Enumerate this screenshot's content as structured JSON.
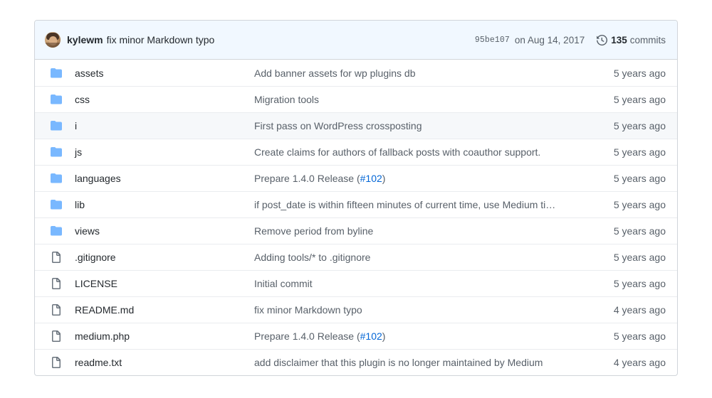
{
  "commit_bar": {
    "avatar_name": "avatar",
    "author": "kylewm",
    "message": "fix minor Markdown typo",
    "sha": "95be107",
    "date": "on Aug 14, 2017",
    "history_icon": "history-clock-icon",
    "commits_count": "135",
    "commits_label": "commits"
  },
  "colors": {
    "folder_blue": "#79b8ff",
    "file_gray": "#6a737d",
    "link_blue": "#0366d6",
    "header_bg": "#f1f8ff",
    "hover_bg": "#f6f8fa",
    "border": "#d1d5da",
    "text": "#24292e",
    "muted": "#586069"
  },
  "rows": [
    {
      "icon": "folder-icon",
      "type": "dir",
      "name": "assets",
      "message": "Add banner assets for wp plugins db",
      "link": null,
      "message_suffix": null,
      "age": "5 years ago",
      "hovered": false
    },
    {
      "icon": "folder-icon",
      "type": "dir",
      "name": "css",
      "message": "Migration tools",
      "link": null,
      "message_suffix": null,
      "age": "5 years ago",
      "hovered": false
    },
    {
      "icon": "folder-icon",
      "type": "dir",
      "name": "i",
      "message": "First pass on WordPress crossposting",
      "link": null,
      "message_suffix": null,
      "age": "5 years ago",
      "hovered": true
    },
    {
      "icon": "folder-icon",
      "type": "dir",
      "name": "js",
      "message": "Create claims for authors of fallback posts with coauthor support.",
      "link": null,
      "message_suffix": null,
      "age": "5 years ago",
      "hovered": false
    },
    {
      "icon": "folder-icon",
      "type": "dir",
      "name": "languages",
      "message": "Prepare 1.4.0 Release (",
      "link": "#102",
      "message_suffix": ")",
      "age": "5 years ago",
      "hovered": false
    },
    {
      "icon": "folder-icon",
      "type": "dir",
      "name": "lib",
      "message": "if post_date is within fifteen minutes of current time, use Medium ti…",
      "link": null,
      "message_suffix": null,
      "age": "5 years ago",
      "hovered": false
    },
    {
      "icon": "folder-icon",
      "type": "dir",
      "name": "views",
      "message": "Remove period from byline",
      "link": null,
      "message_suffix": null,
      "age": "5 years ago",
      "hovered": false
    },
    {
      "icon": "file-icon",
      "type": "file",
      "name": ".gitignore",
      "message": "Adding tools/* to .gitignore",
      "link": null,
      "message_suffix": null,
      "age": "5 years ago",
      "hovered": false
    },
    {
      "icon": "file-icon",
      "type": "file",
      "name": "LICENSE",
      "message": "Initial commit",
      "link": null,
      "message_suffix": null,
      "age": "5 years ago",
      "hovered": false
    },
    {
      "icon": "file-icon",
      "type": "file",
      "name": "README.md",
      "message": "fix minor Markdown typo",
      "link": null,
      "message_suffix": null,
      "age": "4 years ago",
      "hovered": false
    },
    {
      "icon": "file-icon",
      "type": "file",
      "name": "medium.php",
      "message": "Prepare 1.4.0 Release (",
      "link": "#102",
      "message_suffix": ")",
      "age": "5 years ago",
      "hovered": false
    },
    {
      "icon": "file-icon",
      "type": "file",
      "name": "readme.txt",
      "message": "add disclaimer that this plugin is no longer maintained by Medium",
      "link": null,
      "message_suffix": null,
      "age": "4 years ago",
      "hovered": false
    }
  ]
}
